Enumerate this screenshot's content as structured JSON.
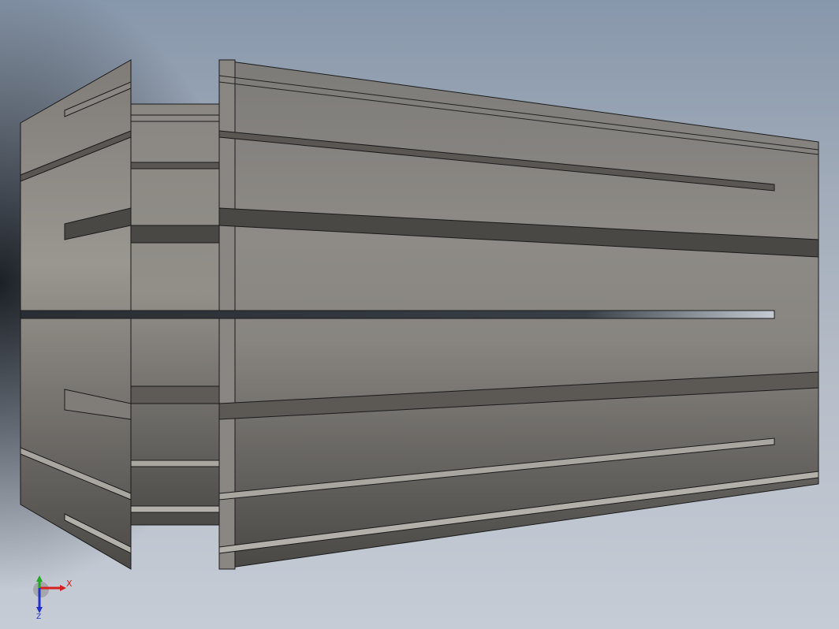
{
  "viewport": {
    "model_name": "",
    "view_type": "3d-model"
  },
  "triad": {
    "x_label": "X",
    "y_label": "Y",
    "z_label": "Z",
    "x_color": "#d42020",
    "y_color": "#22a822",
    "z_color": "#2030c8"
  }
}
